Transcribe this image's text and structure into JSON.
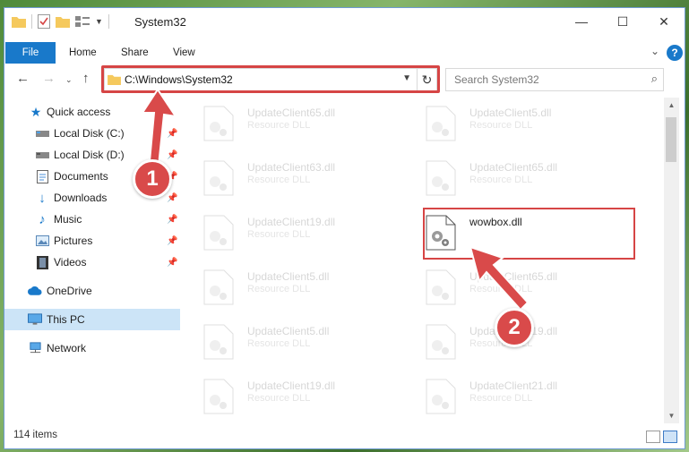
{
  "window": {
    "title": "System32",
    "controls": {
      "minimize": "—",
      "maximize": "☐",
      "close": "✕"
    }
  },
  "ribbon": {
    "tabs": [
      "File",
      "Home",
      "Share",
      "View"
    ],
    "help": "?"
  },
  "address_bar": {
    "path": "C:\\Windows\\System32"
  },
  "search": {
    "placeholder": "Search System32"
  },
  "sidebar": {
    "items": [
      {
        "label": "Quick access",
        "icon": "star-icon",
        "pinned": false
      },
      {
        "label": "Local Disk (C:)",
        "icon": "drive-icon",
        "pinned": true
      },
      {
        "label": "Local Disk (D:)",
        "icon": "drive-icon",
        "pinned": true
      },
      {
        "label": "Documents",
        "icon": "documents-icon",
        "pinned": true
      },
      {
        "label": "Downloads",
        "icon": "download-icon",
        "pinned": true
      },
      {
        "label": "Music",
        "icon": "music-icon",
        "pinned": true
      },
      {
        "label": "Pictures",
        "icon": "pictures-icon",
        "pinned": true
      },
      {
        "label": "Videos",
        "icon": "video-icon",
        "pinned": true
      },
      {
        "label": "OneDrive",
        "icon": "cloud-icon",
        "pinned": false
      },
      {
        "label": "This PC",
        "icon": "computer-icon",
        "pinned": false,
        "selected": true
      },
      {
        "label": "Network",
        "icon": "network-icon",
        "pinned": false
      }
    ]
  },
  "files": [
    {
      "name": "UpdateClient65.dll",
      "type": "Resource DLL",
      "faded": true
    },
    {
      "name": "UpdateClient5.dll",
      "type": "Resource DLL",
      "faded": true
    },
    {
      "name": "UpdateClient63.dll",
      "type": "Resource DLL",
      "faded": true
    },
    {
      "name": "UpdateClient65.dll",
      "type": "Resource DLL",
      "faded": true
    },
    {
      "name": "UpdateClient19.dll",
      "type": "Resource DLL",
      "faded": true
    },
    {
      "name": "wowbox.dll",
      "type": "",
      "faded": false,
      "highlighted": true
    },
    {
      "name": "UpdateClient5.dll",
      "type": "Resource DLL",
      "faded": true
    },
    {
      "name": "UpdateClient65.dll",
      "type": "Resource DLL",
      "faded": true
    },
    {
      "name": "UpdateClient5.dll",
      "type": "Resource DLL",
      "faded": true
    },
    {
      "name": "UpdateClient19.dll",
      "type": "Resource DLL",
      "faded": true
    },
    {
      "name": "UpdateClient19.dll",
      "type": "Resource DLL",
      "faded": true
    },
    {
      "name": "UpdateClient21.dll",
      "type": "Resource DLL",
      "faded": true
    }
  ],
  "status": {
    "item_count": "114 items"
  },
  "annotations": [
    {
      "number": "1"
    },
    {
      "number": "2"
    }
  ],
  "colors": {
    "accent": "#1979ca",
    "highlight": "#d64545",
    "selected": "#cce4f7"
  }
}
